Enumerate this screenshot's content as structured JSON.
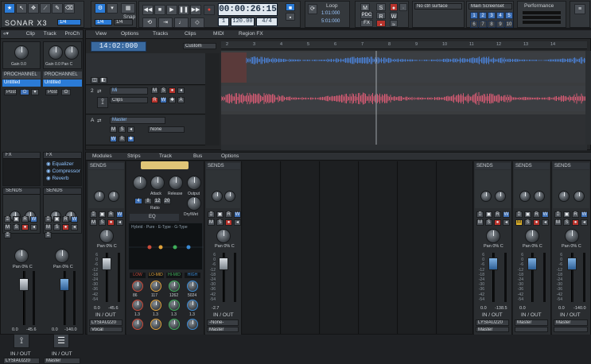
{
  "app": {
    "logo": "SONAR X3",
    "colors": {
      "accent": "#2b7bd6",
      "audio_waveform": "#4a7fd1",
      "audio_waveform2": "#d45a73",
      "selected": "#e0b32a",
      "record": "#b8332c"
    }
  },
  "control_bar": {
    "tools_label": "1/4",
    "snap_label": "1/4",
    "snap_value": "1/4",
    "edit_label": "Snap",
    "transport": {
      "time": "00:00:26:15",
      "bar": "1",
      "tempo": "120.00",
      "meter": "4/4"
    },
    "loop": {
      "title": "Loop",
      "start": "1:01:000",
      "end": "5:01:000"
    },
    "markers": [
      "M",
      "S",
      "R",
      "W"
    ],
    "pdc_label": "PDC",
    "fx_label": "FX",
    "ctrl_surface": "No ctrl surface",
    "screenset": {
      "title": "Main Screenset",
      "numbers": [
        "1",
        "2",
        "3",
        "4",
        "5",
        "6",
        "7",
        "8",
        "9",
        "10"
      ]
    },
    "performance": "Performance"
  },
  "inspector": {
    "tabs": [
      "Clip",
      "Track",
      "ProCh"
    ],
    "gain_label": "Gain 0.0",
    "gain_label2": "Gain 0.0 Pan C",
    "prochannel": [
      "PROCHANNEL",
      "PROCHANNEL"
    ],
    "untitled": [
      "Untitled",
      "Untitled"
    ],
    "post_label": "Post",
    "fx_label": "FX",
    "fx_items": [
      "Equalizer",
      "Compressor",
      "Reverb"
    ],
    "sends_label": "SENDS",
    "pan_label": "Pan 0% C",
    "vol_values": [
      "0.0",
      "-45.6",
      "0.0",
      "-140.0"
    ],
    "io_label": "IN / OUT",
    "out_left": "LYSIAU220",
    "out_right": "Master"
  },
  "track_view": {
    "menus": [
      "View",
      "Options",
      "Tracks",
      "Clips",
      "MIDI",
      "Region FX"
    ],
    "now_time": "14:02:000",
    "custom_label": "Custom",
    "ruler": [
      "2",
      "3",
      "4",
      "5",
      "6",
      "7",
      "8",
      "9",
      "10",
      "11",
      "12",
      "13",
      "14"
    ],
    "tracks": [
      {
        "num": "2",
        "name": "Mi",
        "mode": "Clips"
      },
      {
        "num": "A",
        "name": "Master",
        "route": "None"
      }
    ],
    "vscroll_icon": "scroll-down-icon"
  },
  "console": {
    "menus": [
      "Modules",
      "Strips",
      "Track",
      "Bus",
      "Options"
    ],
    "sends_label": "SENDS",
    "pan_label": "Pan 0% C",
    "io_label": "IN / OUT",
    "eq_label": "EQ",
    "comp_labels": [
      "Attack",
      "Release",
      "Output"
    ],
    "ratio_label": "Ratio",
    "ratio_values": [
      "4",
      "8",
      "12",
      "20"
    ],
    "dry_wet": "Dry/Wet",
    "eq_modes": [
      "Hybrid",
      "Pure",
      "E-Type",
      "G-Type"
    ],
    "band_labels": [
      "LOW",
      "LO-MID",
      "HI-MID",
      "HIGH"
    ],
    "band_freqs": [
      "86",
      "117",
      "1262",
      "5024"
    ],
    "band_q": [
      "1.3",
      "1.3",
      "1.3",
      "1.3"
    ],
    "strips": [
      {
        "vol": "0.0",
        "peak": "-45.6",
        "out": "LYSIAU220",
        "route": "Vocal"
      },
      {
        "vol": "-2.7",
        "peak": "",
        "out": "-None-",
        "route": "Master"
      },
      {
        "vol": "0.0",
        "peak": "-138.5",
        "out": "LYSIAU220",
        "route": "Master"
      },
      {
        "vol": "0.0",
        "peak": "",
        "out": "Master",
        "route": ""
      },
      {
        "vol": "0.0",
        "peak": "-140.0",
        "out": "Master",
        "route": ""
      }
    ],
    "scale": [
      "6",
      "0",
      "-6",
      "-12",
      "-18",
      "-24",
      "-30",
      "-36",
      "-42",
      "-54"
    ]
  }
}
